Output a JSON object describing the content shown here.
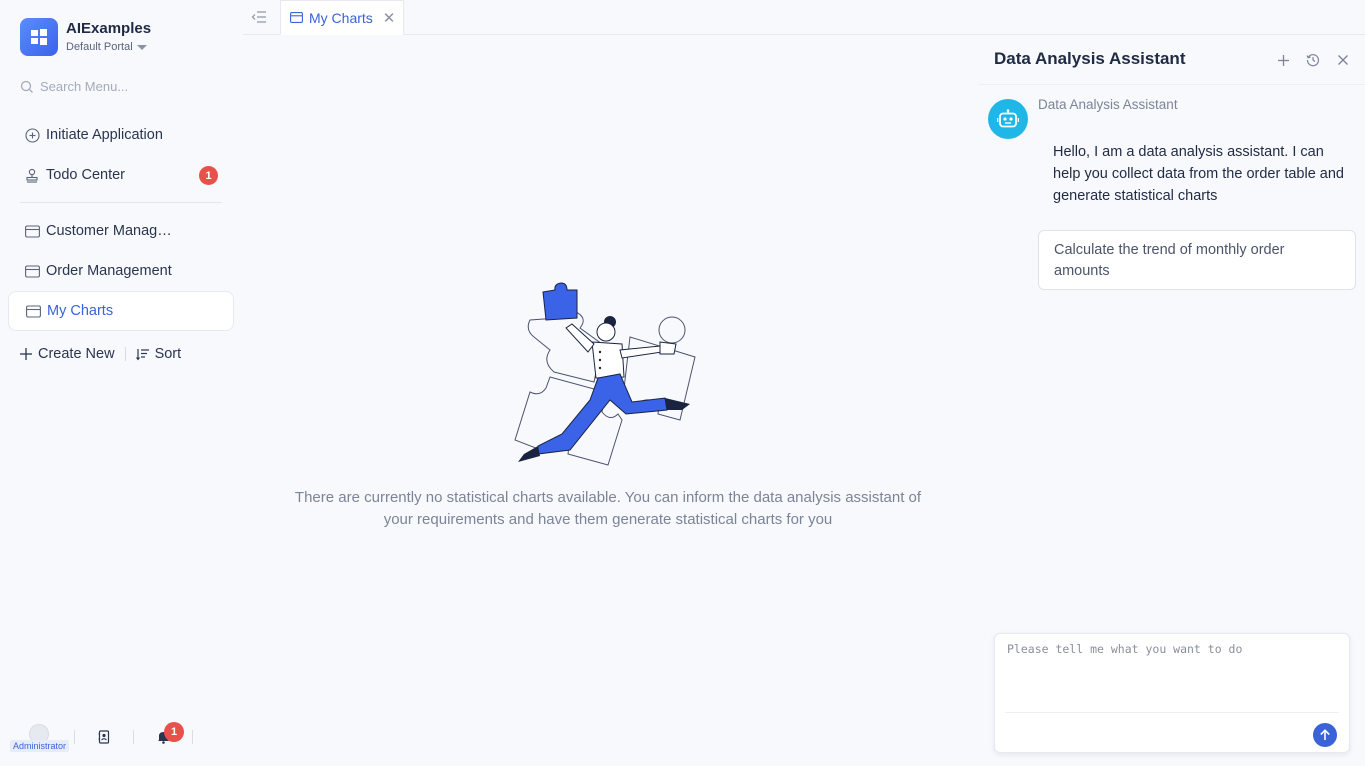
{
  "brand": {
    "name": "AIExamples",
    "portal": "Default Portal"
  },
  "search": {
    "placeholder": "Search Menu..."
  },
  "menu": {
    "initiate": "Initiate Application",
    "todo": "Todo Center",
    "todo_badge": "1",
    "items": [
      {
        "label": "Customer Manag…"
      },
      {
        "label": "Order Management"
      },
      {
        "label": "My Charts"
      }
    ]
  },
  "actions": {
    "create": "Create New",
    "sort": "Sort"
  },
  "footer": {
    "user": "Administrator",
    "notify_badge": "1"
  },
  "tabs": [
    {
      "label": "My Charts"
    }
  ],
  "empty": {
    "message": "There are currently no statistical charts available. You can inform the data analysis assistant of your requirements and have them generate statistical charts for you"
  },
  "assistant": {
    "title": "Data Analysis Assistant",
    "bot_name": "Data Analysis Assistant",
    "greeting": "Hello, I am a data analysis assistant. I can help you collect data from the order table and generate statistical charts",
    "suggestion": "Calculate the trend of monthly order amounts",
    "input_placeholder": "Please tell me what you want to do"
  },
  "colors": {
    "accent": "#3a63d8",
    "badge": "#e8514a",
    "bot": "#1fb7e8"
  }
}
